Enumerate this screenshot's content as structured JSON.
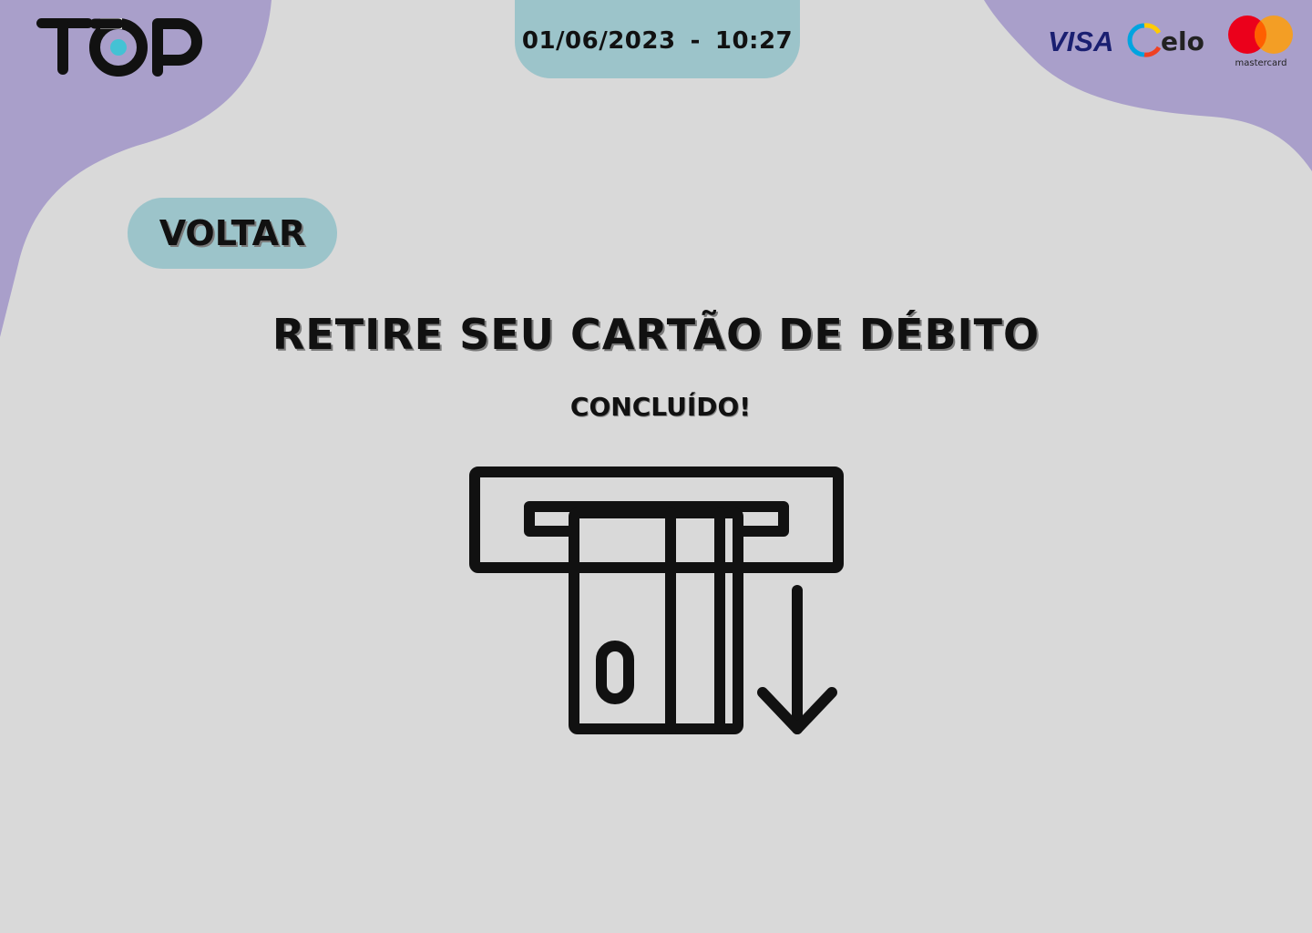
{
  "header": {
    "logo_text": "TOP",
    "date": "01/06/2023",
    "separator": "-",
    "time": "10:27",
    "card_brands": [
      {
        "name": "visa",
        "label": "VISA"
      },
      {
        "name": "elo",
        "label": "elo"
      },
      {
        "name": "mastercard",
        "label": "mastercard"
      }
    ]
  },
  "nav": {
    "back_label": "VOLTAR"
  },
  "main": {
    "title": "RETIRE SEU CARTÃO DE DÉBITO",
    "status": "CONCLUÍDO!",
    "illustration_icon": "atm-card-withdraw-icon"
  },
  "colors": {
    "background": "#d9d9d9",
    "blob_purple": "#a99fca",
    "pill_teal": "#9cc4ca",
    "logo_dot": "#43c2d4",
    "visa_blue": "#1a1f71",
    "mastercard_red": "#eb001b",
    "mastercard_orange": "#f79e1b"
  }
}
